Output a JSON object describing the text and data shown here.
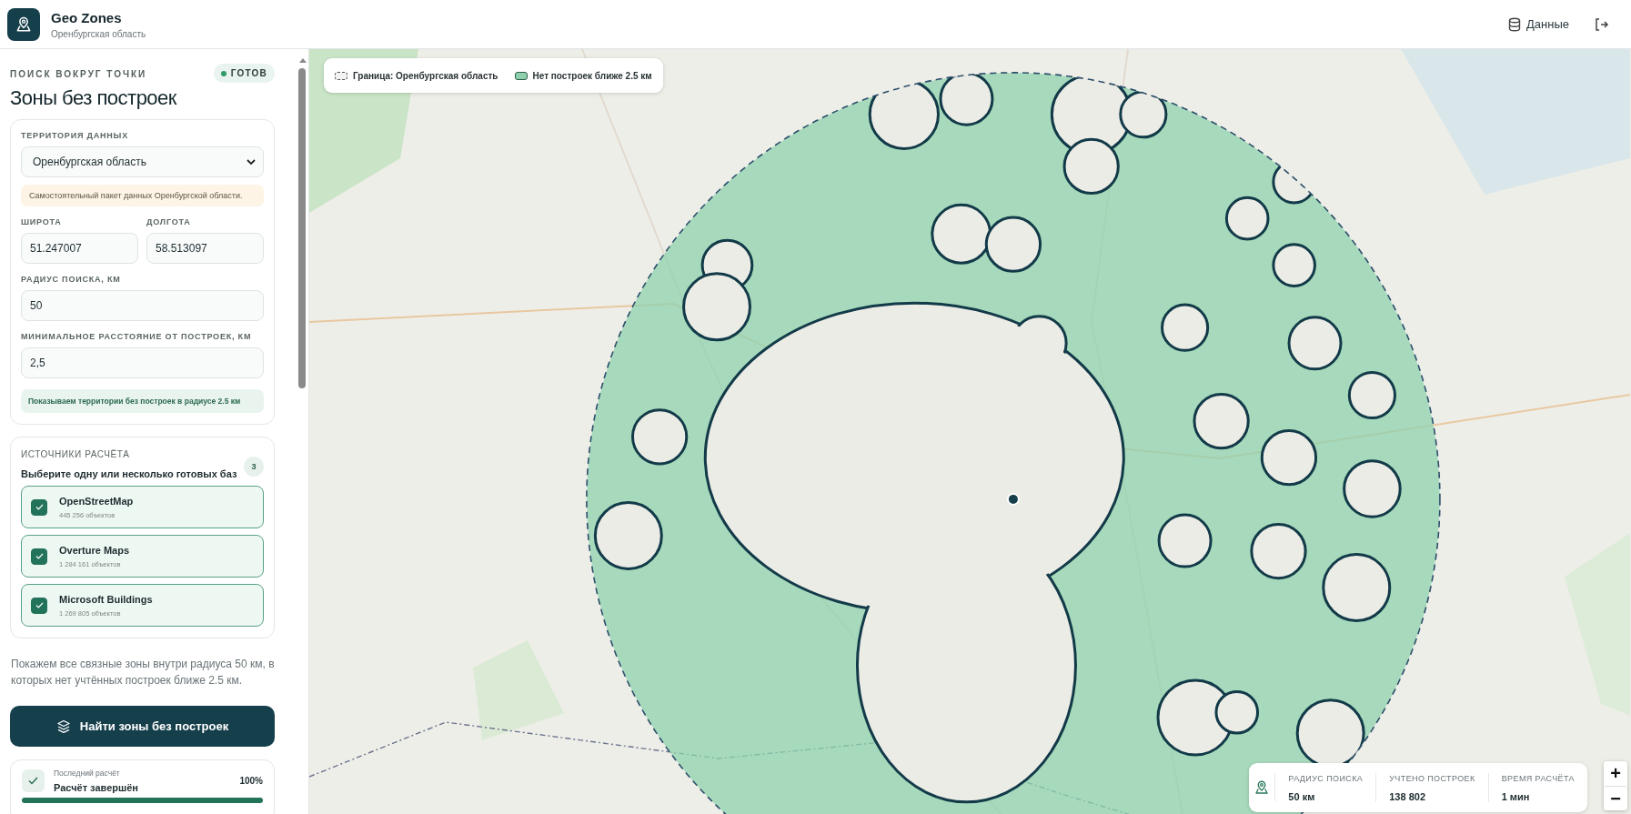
{
  "header": {
    "title": "Geo Zones",
    "subtitle": "Оренбургская область",
    "data_button": "Данные"
  },
  "panel": {
    "eyebrow": "ПОИСК ВОКРУГ ТОЧКИ",
    "status": {
      "label": "ГОТОВ",
      "on": true
    },
    "title": "Зоны без построек"
  },
  "form": {
    "territory": {
      "label": "ТЕРРИТОРИЯ ДАННЫХ",
      "value": "Оренбургская область"
    },
    "note": "Самостоятельный пакет данных Оренбургской области.",
    "coords": [
      {
        "label": "ШИРОТА",
        "value": "51.247007"
      },
      {
        "label": "ДОЛГОТА",
        "value": "58.513097"
      }
    ],
    "radius": {
      "label": "РАДИУС ПОИСКА, КМ",
      "value": "50"
    },
    "min_distance": {
      "label": "МИНИМАЛЬНОЕ РАССТОЯНИЕ ОТ ПОСТРОЕК, КМ",
      "value": "2,5"
    },
    "hint": "Показываем территории без построек в радиусе 2.5 км"
  },
  "sources": {
    "label": "ИСТОЧНИКИ РАСЧЁТА",
    "subtitle": "Выберите одну или несколько готовых баз",
    "count": "3",
    "items": [
      {
        "name": "OpenStreetMap",
        "count": "445 256 объектов",
        "checked": true
      },
      {
        "name": "Overture Maps",
        "count": "1 284 161 объектов",
        "checked": true
      },
      {
        "name": "Microsoft Buildings",
        "count": "1 269 805 объектов",
        "checked": true
      }
    ]
  },
  "summary": "Покажем все связные зоны внутри радиуса 50 км, в которых нет учтённых построек ближе 2.5 км.",
  "action_button": "Найти зоны без построек",
  "last_run": {
    "label": "Последний расчёт",
    "status": "Расчёт завершён",
    "percent": "100%",
    "level": 1
  },
  "map": {
    "legend": [
      {
        "kind": "border",
        "label": "Граница: Оренбургская область"
      },
      {
        "kind": "zone",
        "label": "Нет построек ближе 2.5 км"
      }
    ],
    "stats": [
      {
        "label": "РАДИУС ПОИСКА",
        "value": "50 км"
      },
      {
        "label": "УЧТЕНО ПОСТРОЕК",
        "value": "138 802"
      },
      {
        "label": "ВРЕМЯ РАСЧЁТА",
        "value": "1 мин"
      }
    ],
    "zoom_in": "+",
    "zoom_out": "−"
  }
}
